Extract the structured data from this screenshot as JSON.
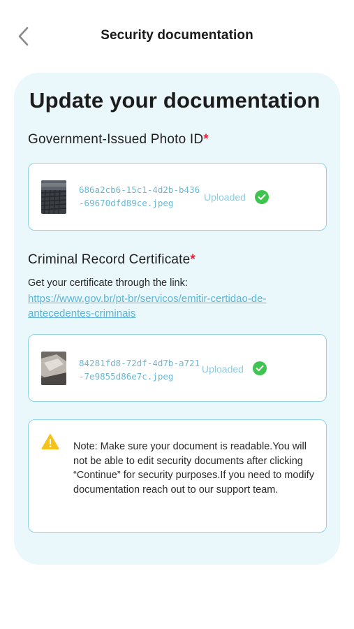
{
  "header": {
    "title": "Security documentation",
    "back_icon": "chevron-left-icon"
  },
  "main": {
    "title": "Update your documentation"
  },
  "photo_id": {
    "label": "Government-Issued Photo ID",
    "required_mark": "*",
    "file_name": "686a2cb6-15c1-4d2b-b436-69670dfd89ce.jpeg",
    "status": "Uploaded"
  },
  "criminal_record": {
    "label": "Criminal Record Certificate",
    "required_mark": "*",
    "instructions": "Get your certificate through the link:",
    "link": "https://www.gov.br/pt-br/servicos/emitir-certidao-de-antecedentes-criminais",
    "file_name": "84281fd8-72df-4d7b-a721-7e9855d86e7c.jpeg",
    "status": "Uploaded"
  },
  "note": {
    "text": "Note: Make sure your document is readable.You will not be able to edit security documents after clicking “Continue” for security purposes.If you need to modify documentation reach out to our support team."
  },
  "colors": {
    "accent": "#5db4d6",
    "card_background": "#eaf7fb",
    "success": "#3ec44f",
    "warning": "#f4c21a",
    "required": "#e0283a"
  }
}
